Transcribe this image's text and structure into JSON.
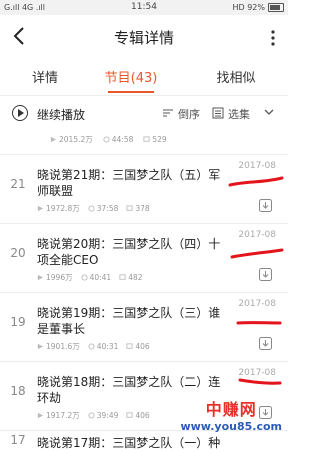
{
  "status_bar": {
    "left": "G.ıll 4G .ıll",
    "time": "11:54",
    "right": "HD 92%"
  },
  "header": {
    "title": "专辑详情"
  },
  "tabs": [
    {
      "label": "详情",
      "active": false
    },
    {
      "label": "节目(43)",
      "active": true
    },
    {
      "label": "找相似",
      "active": false
    }
  ],
  "toolbar": {
    "continue_label": "继续播放",
    "sort_label": "倒序",
    "select_label": "选集"
  },
  "partial_row": {
    "date": "2015.2万",
    "duration": "44:58",
    "comments": "529"
  },
  "episodes": [
    {
      "index": "21",
      "title": "晓说第21期：三国梦之队（五）军师联盟",
      "date": "2017-08",
      "plays": "1972.8万",
      "duration": "37:58",
      "comments": "378"
    },
    {
      "index": "20",
      "title": "晓说第20期：三国梦之队（四）十项全能CEO",
      "date": "2017-08",
      "plays": "1996万",
      "duration": "40:41",
      "comments": "482"
    },
    {
      "index": "19",
      "title": "晓说第19期：三国梦之队（三）谁是董事长",
      "date": "2017-08",
      "plays": "1901.6万",
      "duration": "40:31",
      "comments": "406"
    },
    {
      "index": "18",
      "title": "晓说第18期：三国梦之队（二）连环劫",
      "date": "2017-08",
      "plays": "1917.2万",
      "duration": "39:49",
      "comments": "406"
    },
    {
      "index": "17",
      "title": "晓说第17期：三国梦之队（一）种",
      "date": "2017-08",
      "plays": "",
      "duration": "",
      "comments": ""
    }
  ],
  "watermark": {
    "title": "中赚网",
    "url": "www.you85.com"
  },
  "colors": {
    "accent": "#e8582b",
    "annotation_red": "#e3141b"
  }
}
